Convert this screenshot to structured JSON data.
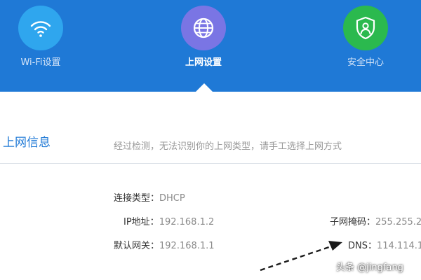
{
  "nav": {
    "items": [
      {
        "label": "Wi-Fi设置",
        "icon": "wifi-icon",
        "color": "#2fa6ee"
      },
      {
        "label": "上网设置",
        "icon": "globe-icon",
        "color": "#7a75e4",
        "active": true
      },
      {
        "label": "安全中心",
        "icon": "shield-icon",
        "color": "#2bb94e"
      }
    ]
  },
  "section": {
    "title": "上网信息",
    "notice": "经过检测，无法识别你的上网类型，请手工选择上网方式"
  },
  "info": {
    "connection_type_label": "连接类型：",
    "connection_type_value": "DHCP",
    "ip_label": "IP地址：",
    "ip_value": "192.168.1.2",
    "subnet_label": "子网掩码：",
    "subnet_value": "255.255.2",
    "gateway_label": "默认网关：",
    "gateway_value": "192.168.1.1",
    "dns_label": "DNS：",
    "dns_value": "114.114.1"
  },
  "watermark": "头条 @jingfang",
  "colors": {
    "header": "#1f79d6",
    "accent": "#1f79d6"
  }
}
